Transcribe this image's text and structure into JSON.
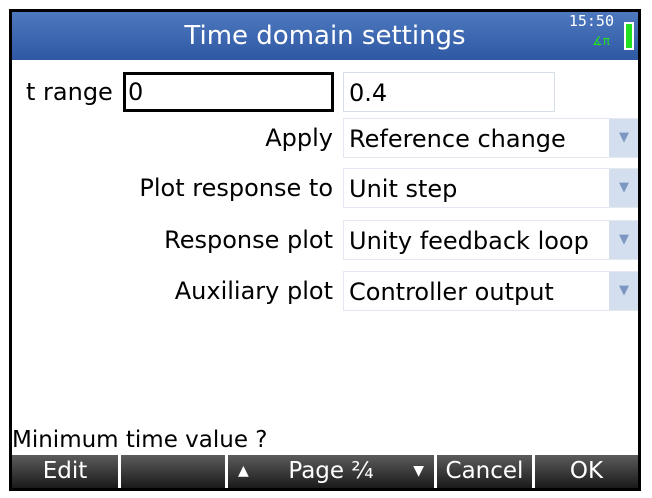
{
  "header": {
    "title": "Time domain settings",
    "clock": "15:50",
    "angle_mode": "∡π"
  },
  "form": {
    "t_range": {
      "label": "t range",
      "min": "0",
      "max": "0.4"
    },
    "apply": {
      "label": "Apply",
      "value": "Reference change"
    },
    "plot_response_to": {
      "label": "Plot response to",
      "value": "Unit step"
    },
    "response_plot": {
      "label": "Response plot",
      "value": "Unity feedback loop"
    },
    "auxiliary_plot": {
      "label": "Auxiliary plot",
      "value": "Controller output"
    }
  },
  "help_text": "Minimum time value ?",
  "softkeys": {
    "edit": "Edit",
    "blank": "",
    "page": "Page ²⁄₄",
    "page_up_glyph": "▲",
    "page_down_glyph": "▼",
    "cancel": "Cancel",
    "ok": "OK"
  },
  "colors": {
    "title_bar": "#3a63ad",
    "battery": "#23e023",
    "dropdown_arrow_bg": "#d3deef"
  }
}
